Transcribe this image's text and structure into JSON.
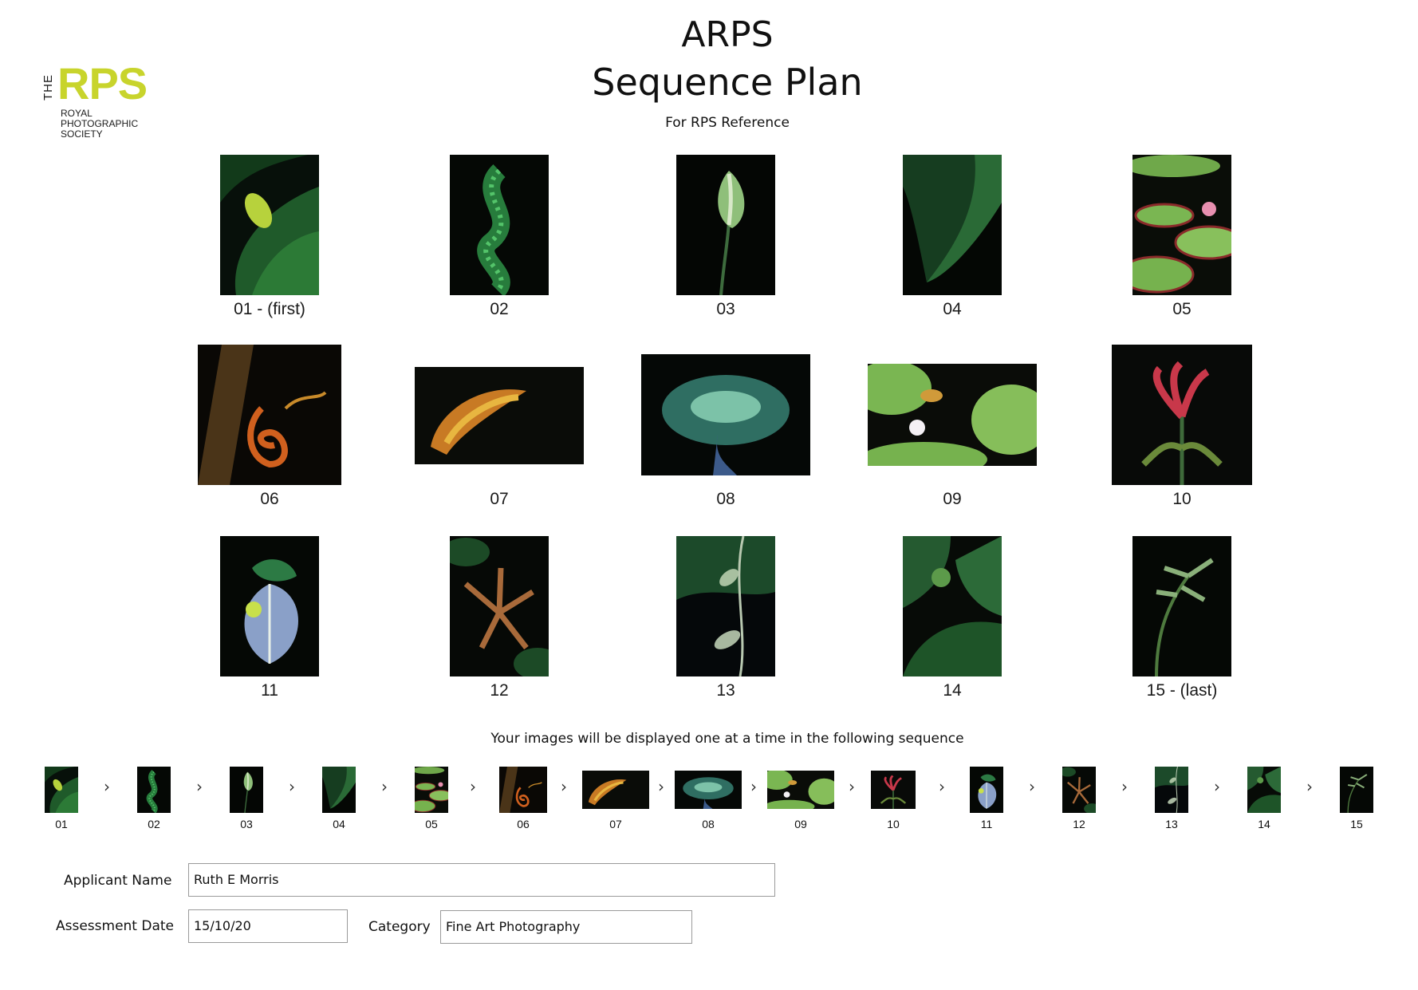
{
  "logo": {
    "the": "THE",
    "rps": "RPS",
    "society": "ROYAL\nPHOTOGRAPHIC\nSOCIETY"
  },
  "header": {
    "title": "ARPS",
    "subtitle": "Sequence Plan",
    "reference": "For RPS Reference"
  },
  "images": [
    {
      "caption": "01 - (first)",
      "seq": "01",
      "icon": "calla-leaf-photo"
    },
    {
      "caption": "02",
      "seq": "02",
      "icon": "fern-frond-photo"
    },
    {
      "caption": "03",
      "seq": "03",
      "icon": "spathe-flower-photo"
    },
    {
      "caption": "04",
      "seq": "04",
      "icon": "folded-leaf-photo"
    },
    {
      "caption": "05",
      "seq": "05",
      "icon": "lily-pads-photo"
    },
    {
      "caption": "06",
      "seq": "06",
      "icon": "orange-tendril-photo"
    },
    {
      "caption": "07",
      "seq": "07",
      "icon": "orange-bloom-photo"
    },
    {
      "caption": "08",
      "seq": "08",
      "icon": "teal-flower-photo"
    },
    {
      "caption": "09",
      "seq": "09",
      "icon": "water-lily-photo"
    },
    {
      "caption": "10",
      "seq": "10",
      "icon": "red-bloom-photo"
    },
    {
      "caption": "11",
      "seq": "11",
      "icon": "variegated-leaf-photo"
    },
    {
      "caption": "12",
      "seq": "12",
      "icon": "leaf-rosette-photo"
    },
    {
      "caption": "13",
      "seq": "13",
      "icon": "stem-leaves-photo"
    },
    {
      "caption": "14",
      "seq": "14",
      "icon": "curled-leaf-photo"
    },
    {
      "caption": "15 - (last)",
      "seq": "15",
      "icon": "sapling-photo"
    }
  ],
  "sequence_note": "Your images will be displayed one at a time in the following sequence",
  "form": {
    "applicant_label": "Applicant Name",
    "applicant_value": "Ruth E Morris",
    "date_label": "Assessment Date",
    "date_value": "15/10/20",
    "category_label": "Category",
    "category_value": "Fine Art Photography"
  },
  "arrow_glyph": "›",
  "colors": {
    "brand": "#c8d42c",
    "photo_bg": "#060a06"
  }
}
